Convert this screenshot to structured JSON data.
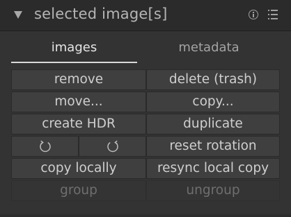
{
  "header": {
    "title": "selected image[s]",
    "collapse_icon": "triangle-down-icon",
    "info_icon": "info-icon",
    "menu_icon": "presets-menu-icon"
  },
  "tabs": [
    {
      "label": "images",
      "active": true
    },
    {
      "label": "metadata",
      "active": false
    }
  ],
  "buttons": {
    "remove": "remove",
    "delete": "delete (trash)",
    "move": "move...",
    "copy": "copy...",
    "create_hdr": "create HDR",
    "duplicate": "duplicate",
    "rotate_ccw_icon": "rotate-counterclockwise-icon",
    "rotate_cw_icon": "rotate-clockwise-icon",
    "reset_rotation": "reset rotation",
    "copy_locally": "copy locally",
    "resync_local_copy": "resync local copy",
    "group": "group",
    "ungroup": "ungroup"
  },
  "colors": {
    "panel_bg": "#333333",
    "header_bg": "#2b2b2b",
    "button_bg": "#3f3f3f",
    "text": "#cfcfcf",
    "disabled_text": "#6f6f6f"
  }
}
